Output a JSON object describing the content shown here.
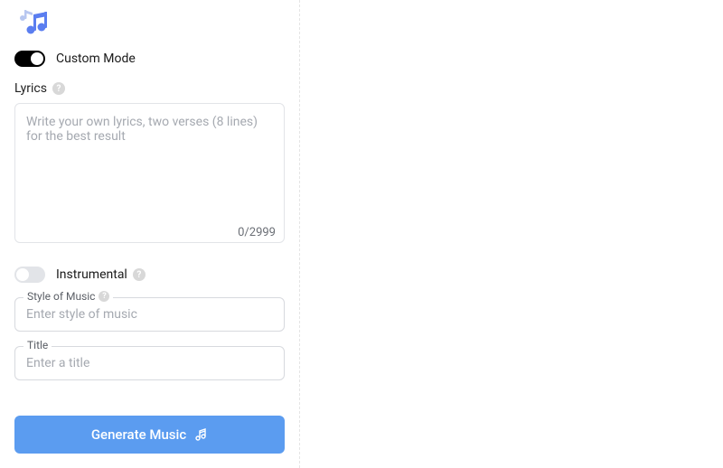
{
  "customMode": {
    "label": "Custom Mode",
    "on": true
  },
  "lyrics": {
    "label": "Lyrics",
    "placeholder": "Write your own lyrics, two verses (8 lines) for the best result",
    "value": "",
    "counter": "0/2999"
  },
  "instrumental": {
    "label": "Instrumental",
    "on": false
  },
  "style": {
    "label": "Style of Music",
    "placeholder": "Enter style of music",
    "value": ""
  },
  "title": {
    "label": "Title",
    "placeholder": "Enter a title",
    "value": ""
  },
  "generate": {
    "label": "Generate Music"
  }
}
